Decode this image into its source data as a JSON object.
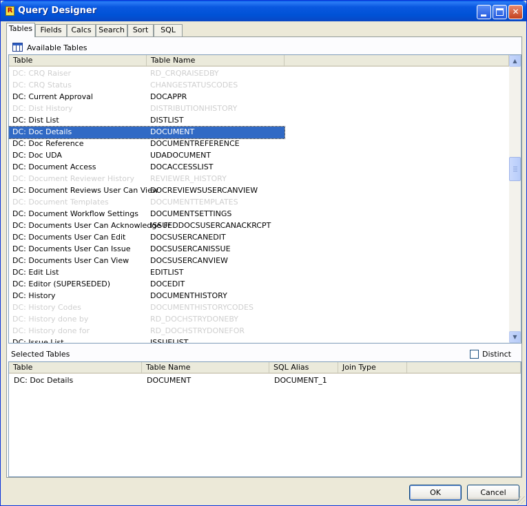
{
  "window": {
    "title": "Query Designer",
    "app_icon": "R"
  },
  "tabs": [
    "Tables",
    "Fields",
    "Calcs",
    "Search",
    "Sort",
    "SQL"
  ],
  "available": {
    "label": "Available Tables",
    "columns": [
      "Table",
      "Table Name"
    ],
    "rows": [
      {
        "table": "DC: CRQ Raiser",
        "name": "RD_CRQRAISEDBY",
        "state": "disabled"
      },
      {
        "table": "DC: CRQ Status",
        "name": "CHANGESTATUSCODES",
        "state": "disabled"
      },
      {
        "table": "DC: Current Approval",
        "name": "DOCAPPR",
        "state": "normal"
      },
      {
        "table": "DC: Dist History",
        "name": "DISTRIBUTIONHISTORY",
        "state": "disabled"
      },
      {
        "table": "DC: Dist List",
        "name": "DISTLIST",
        "state": "normal"
      },
      {
        "table": "DC: Doc Details",
        "name": "DOCUMENT",
        "state": "selected"
      },
      {
        "table": "DC: Doc Reference",
        "name": "DOCUMENTREFERENCE",
        "state": "normal"
      },
      {
        "table": "DC: Doc UDA",
        "name": "UDADOCUMENT",
        "state": "normal"
      },
      {
        "table": "DC: Document Access",
        "name": "DOCACCESSLIST",
        "state": "normal"
      },
      {
        "table": "DC: Document Reviewer History",
        "name": "REVIEWER_HISTORY",
        "state": "disabled"
      },
      {
        "table": "DC: Document Reviews User Can View",
        "name": "DOCREVIEWSUSERCANVIEW",
        "state": "normal"
      },
      {
        "table": "DC: Document Templates",
        "name": "DOCUMENTTEMPLATES",
        "state": "disabled"
      },
      {
        "table": "DC: Document Workflow Settings",
        "name": "DOCUMENTSETTINGS",
        "state": "normal"
      },
      {
        "table": "DC: Documents User Can Acknowledge Fr",
        "name": "ISSUEDDOCSUSERCANACKRCPT",
        "state": "normal"
      },
      {
        "table": "DC: Documents User Can Edit",
        "name": "DOCSUSERCANEDIT",
        "state": "normal"
      },
      {
        "table": "DC: Documents User Can Issue",
        "name": "DOCSUSERCANISSUE",
        "state": "normal"
      },
      {
        "table": "DC: Documents User Can View",
        "name": "DOCSUSERCANVIEW",
        "state": "normal"
      },
      {
        "table": "DC: Edit List",
        "name": "EDITLIST",
        "state": "normal"
      },
      {
        "table": "DC: Editor (SUPERSEDED)",
        "name": "DOCEDIT",
        "state": "normal"
      },
      {
        "table": "DC: History",
        "name": "DOCUMENTHISTORY",
        "state": "normal"
      },
      {
        "table": "DC: History Codes",
        "name": "DOCUMENTHISTORYCODES",
        "state": "disabled"
      },
      {
        "table": "DC: History done by",
        "name": "RD_DOCHSTRYDONEBY",
        "state": "disabled"
      },
      {
        "table": "DC: History done for",
        "name": "RD_DOCHSTRYDONEFOR",
        "state": "disabled"
      },
      {
        "table": "DC: Issue List",
        "name": "ISSUELIST",
        "state": "normal"
      }
    ]
  },
  "selected": {
    "label": "Selected Tables",
    "distinct_label": "Distinct",
    "distinct_checked": false,
    "columns": [
      "Table",
      "Table Name",
      "SQL Alias",
      "Join Type"
    ],
    "rows": [
      {
        "table": "DC: Doc Details",
        "name": "DOCUMENT",
        "alias": "DOCUMENT_1",
        "join": ""
      }
    ]
  },
  "buttons": {
    "ok": "OK",
    "cancel": "Cancel"
  },
  "colors": {
    "selection": "#316ac5",
    "disabled_text": "#cfcfcf",
    "titlebar": "#0a58e0"
  }
}
